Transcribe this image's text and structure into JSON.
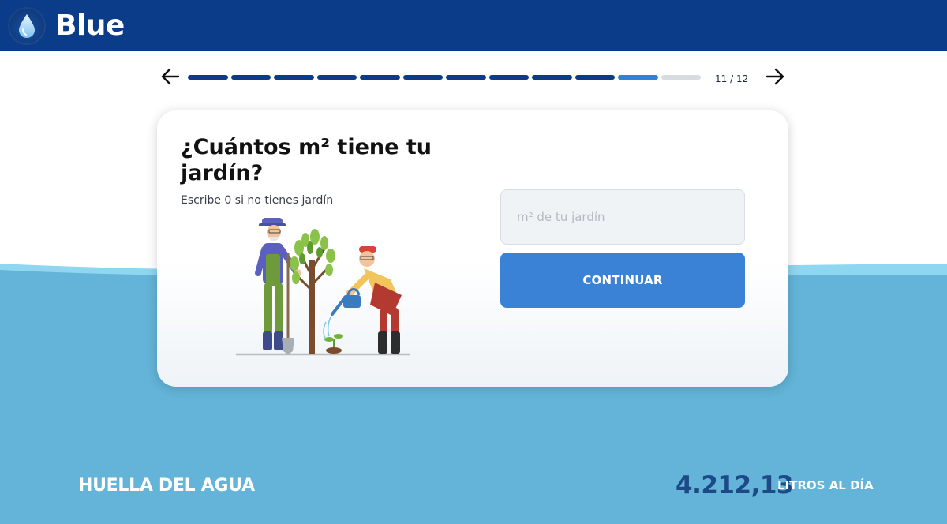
{
  "app": {
    "title": "Blue",
    "logo_icon": "water-drop-icon"
  },
  "colors": {
    "header": "#0b3c8a",
    "accent": "#3a82d6",
    "water": "#63b4d8",
    "water_light": "#8fd6f0",
    "progress_done": "#0b3c8a",
    "progress_current": "#3182d6",
    "progress_pending": "#d8dbe0"
  },
  "progress": {
    "total": 12,
    "current": 11,
    "counter": "11 / 12",
    "prev_icon": "arrow-left-icon",
    "next_icon": "arrow-right-icon"
  },
  "question": {
    "title": "¿Cuántos m² tiene tu jardín?",
    "hint": "Escribe 0 si no tienes jardín",
    "illustration": "gardeners-planting-tree-illustration",
    "input": {
      "value": "",
      "placeholder": "m² de tu jardín"
    },
    "button_label": "CONTINUAR"
  },
  "footer": {
    "label": "HUELLA DEL AGUA",
    "value": "4.212,13",
    "unit": "LITROS AL DÍA"
  }
}
